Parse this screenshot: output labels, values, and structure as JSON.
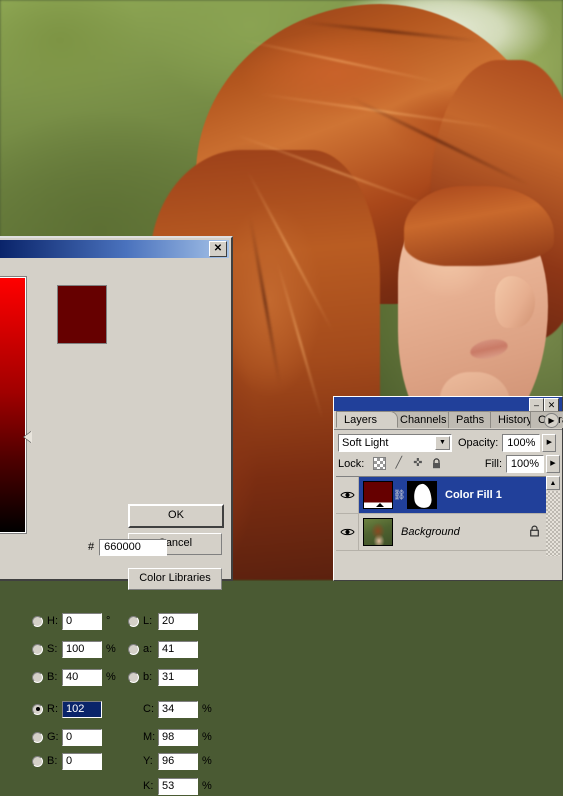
{
  "photo": {
    "description": "Profile photo of a woman with red hair against a blurred green foliage background"
  },
  "color_picker": {
    "title": "",
    "close_label": "✕",
    "swatch_color": "#660000",
    "buttons": {
      "ok": "OK",
      "cancel": "Cancel",
      "color_libraries": "Color Libraries"
    },
    "fields": [
      {
        "name": "H",
        "label": "H:",
        "value": "0",
        "unit": "°",
        "radio": false,
        "selected": false
      },
      {
        "name": "S",
        "label": "S:",
        "value": "100",
        "unit": "%",
        "radio": false,
        "selected": false
      },
      {
        "name": "B",
        "label": "B:",
        "value": "40",
        "unit": "%",
        "radio": false,
        "selected": false
      },
      {
        "name": "R",
        "label": "R:",
        "value": "102",
        "unit": "",
        "radio": true,
        "selected": true
      },
      {
        "name": "G",
        "label": "G:",
        "value": "0",
        "unit": "",
        "radio": false,
        "selected": false
      },
      {
        "name": "B2",
        "label": "B:",
        "value": "0",
        "unit": "",
        "radio": false,
        "selected": false
      }
    ],
    "lab_fields": [
      {
        "name": "L",
        "label": "L:",
        "value": "20",
        "unit": ""
      },
      {
        "name": "a",
        "label": "a:",
        "value": "41",
        "unit": ""
      },
      {
        "name": "b",
        "label": "b:",
        "value": "31",
        "unit": ""
      }
    ],
    "cmyk_fields": [
      {
        "name": "C",
        "label": "C:",
        "value": "34",
        "unit": "%"
      },
      {
        "name": "M",
        "label": "M:",
        "value": "98",
        "unit": "%"
      },
      {
        "name": "Y",
        "label": "Y:",
        "value": "96",
        "unit": "%"
      },
      {
        "name": "K",
        "label": "K:",
        "value": "53",
        "unit": "%"
      }
    ],
    "hex": {
      "prefix": "#",
      "value": "660000"
    }
  },
  "layers_panel": {
    "minimize_label": "–",
    "close_label": "✕",
    "menu_label": "▶",
    "tabs": [
      {
        "label": "Layers",
        "active": true
      },
      {
        "label": "Channels",
        "active": false
      },
      {
        "label": "Paths",
        "active": false
      },
      {
        "label": "History",
        "active": false
      },
      {
        "label": "Character",
        "active": false
      }
    ],
    "blend_mode": "Soft Light",
    "blend_arrow": "▼",
    "opacity_label": "Opacity:",
    "opacity_value": "100%",
    "opacity_arrow": "▶",
    "lock_label": "Lock:",
    "lock_icons": [
      "transparency-checker-icon",
      "brush-icon",
      "move-icon",
      "lock-icon"
    ],
    "lock_brush_glyph": "╱",
    "lock_move_glyph": "✜",
    "lock_lock_glyph": "ὑ2",
    "fill_label": "Fill:",
    "fill_value": "100%",
    "fill_arrow": "▶",
    "scroll_up_arrow": "▲",
    "rows": [
      {
        "name": "Color Fill 1",
        "visible_glyph": "◉",
        "selected": true,
        "italic": false,
        "has_mask": true,
        "link_glyph": "⛓",
        "locked": false
      },
      {
        "name": "Background",
        "visible_glyph": "◉",
        "selected": false,
        "italic": true,
        "has_mask": false,
        "link_glyph": "",
        "locked": true,
        "lock_glyph": "ὑ2"
      }
    ]
  }
}
